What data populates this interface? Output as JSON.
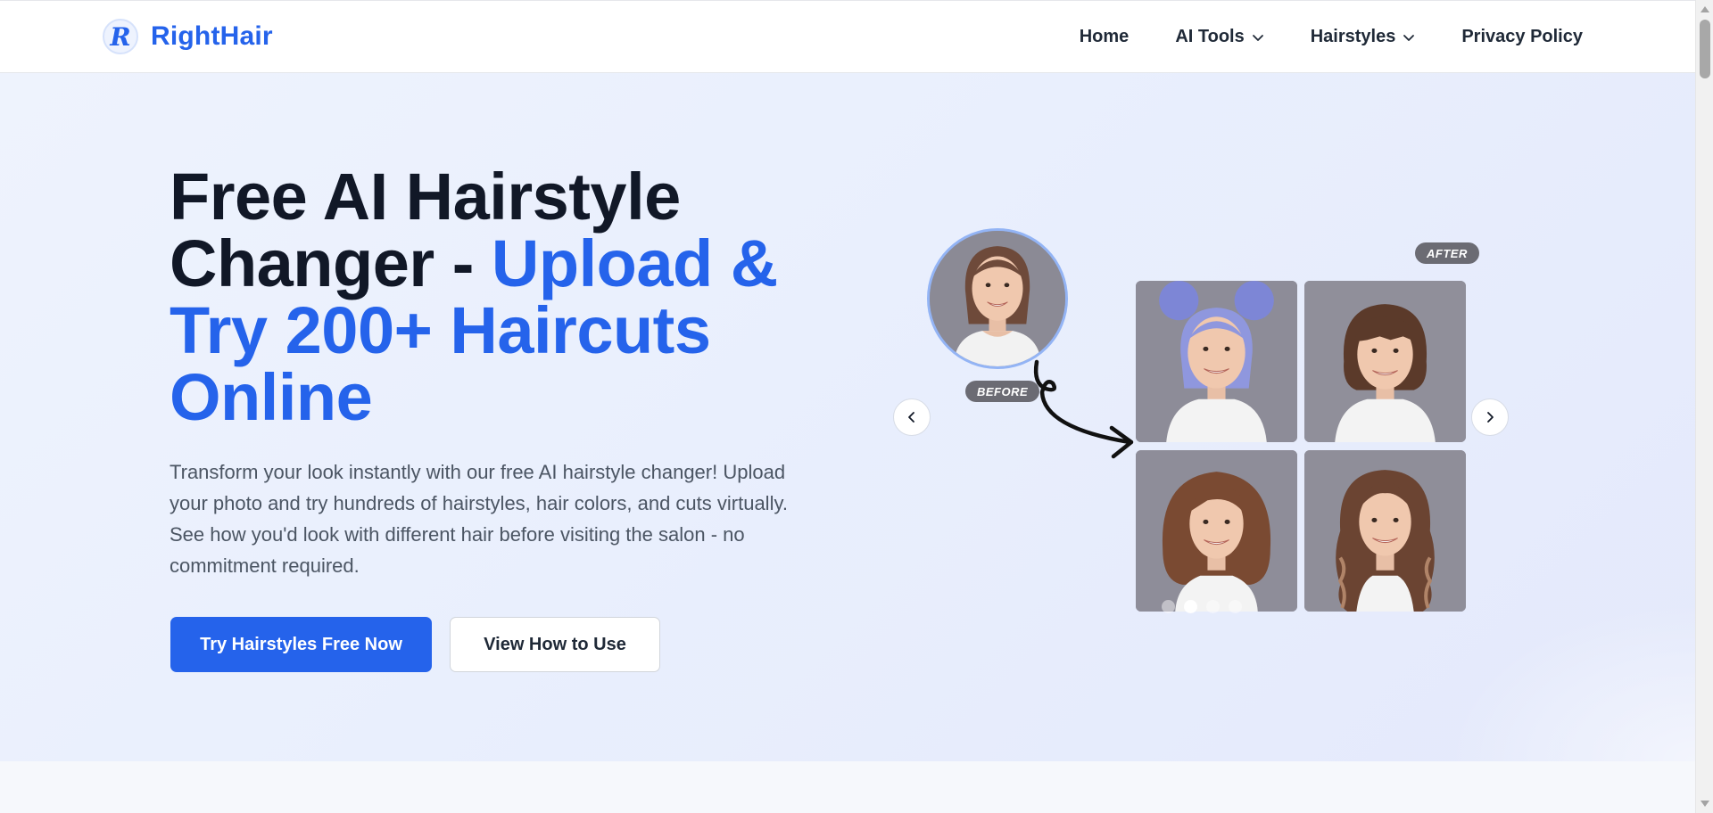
{
  "header": {
    "logo_letter": "R",
    "logo_text": "RightHair",
    "nav": [
      {
        "label": "Home",
        "has_dropdown": false
      },
      {
        "label": "AI Tools",
        "has_dropdown": true
      },
      {
        "label": "Hairstyles",
        "has_dropdown": true
      },
      {
        "label": "Privacy Policy",
        "has_dropdown": false
      }
    ]
  },
  "hero": {
    "title_dark": "Free AI Hairstyle Changer - ",
    "title_accent": "Upload & Try 200+ Haircuts Online",
    "description": "Transform your look instantly with our free AI hairstyle changer! Upload your photo and try hundreds of hairstyles, hair colors, and cuts virtually. See how you'd look with different hair before visiting the salon - no commitment required.",
    "primary_button": "Try Hairstyles Free Now",
    "secondary_button": "View How to Use"
  },
  "carousel": {
    "before_label": "BEFORE",
    "after_label": "AFTER",
    "slide_count": 4,
    "active_slide": 1,
    "images": [
      {
        "name": "blue-space-buns",
        "hair_color": "#7d86d6"
      },
      {
        "name": "bob-with-bangs",
        "hair_color": "#5b3a2a"
      },
      {
        "name": "layered-medium",
        "hair_color": "#7a4a32"
      },
      {
        "name": "long-waves",
        "hair_color": "#6b4432"
      }
    ],
    "before_hair_color": "#6e4a3a"
  },
  "colors": {
    "accent": "#2563eb",
    "text_dark": "#111827",
    "body_text": "#4b5563"
  }
}
